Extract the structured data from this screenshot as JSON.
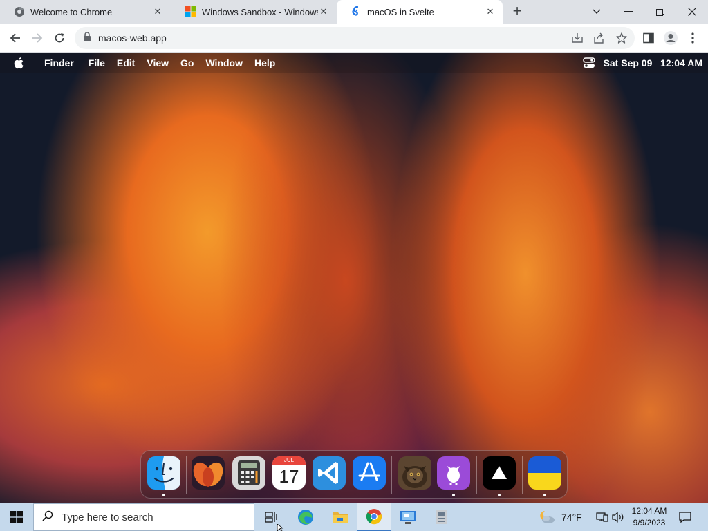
{
  "browser": {
    "tabs": [
      {
        "title": "Welcome to Chrome",
        "icon": "chrome-globe-icon",
        "active": false
      },
      {
        "title": "Windows Sandbox - Windows Se",
        "icon": "windows-logo-icon",
        "active": false
      },
      {
        "title": "macOS in Svelte",
        "icon": "svelte-logo-icon",
        "active": true
      }
    ],
    "url": "macos-web.app",
    "icons": [
      "back-arrow-icon",
      "forward-arrow-icon",
      "reload-icon",
      "lock-icon",
      "install-app-icon",
      "share-icon",
      "bookmark-star-icon",
      "side-panel-icon",
      "profile-icon",
      "kebab-menu-icon"
    ]
  },
  "macos": {
    "menubar": {
      "app_name": "Finder",
      "menus": [
        "File",
        "Edit",
        "View",
        "Go",
        "Window",
        "Help"
      ],
      "datetime": "Sat Sep 09   12:04 AM"
    },
    "dock": {
      "calendar_month": "JUL",
      "calendar_day": "17",
      "apps": [
        "Finder",
        "Wallpapers",
        "Calculator",
        "Calendar",
        "VS Code",
        "App Store",
        "Purus Twitter",
        "GitHub",
        "Vercel",
        "Ukraine"
      ]
    }
  },
  "taskbar": {
    "search_placeholder": "Type here to search",
    "weather": "74°F",
    "time": "12:04 AM",
    "date": "9/9/2023"
  },
  "colors": {
    "taskbar_bg": "#c5d9ec",
    "tabstrip_bg": "#dee1e6",
    "accent_blue": "#1a73e8"
  }
}
